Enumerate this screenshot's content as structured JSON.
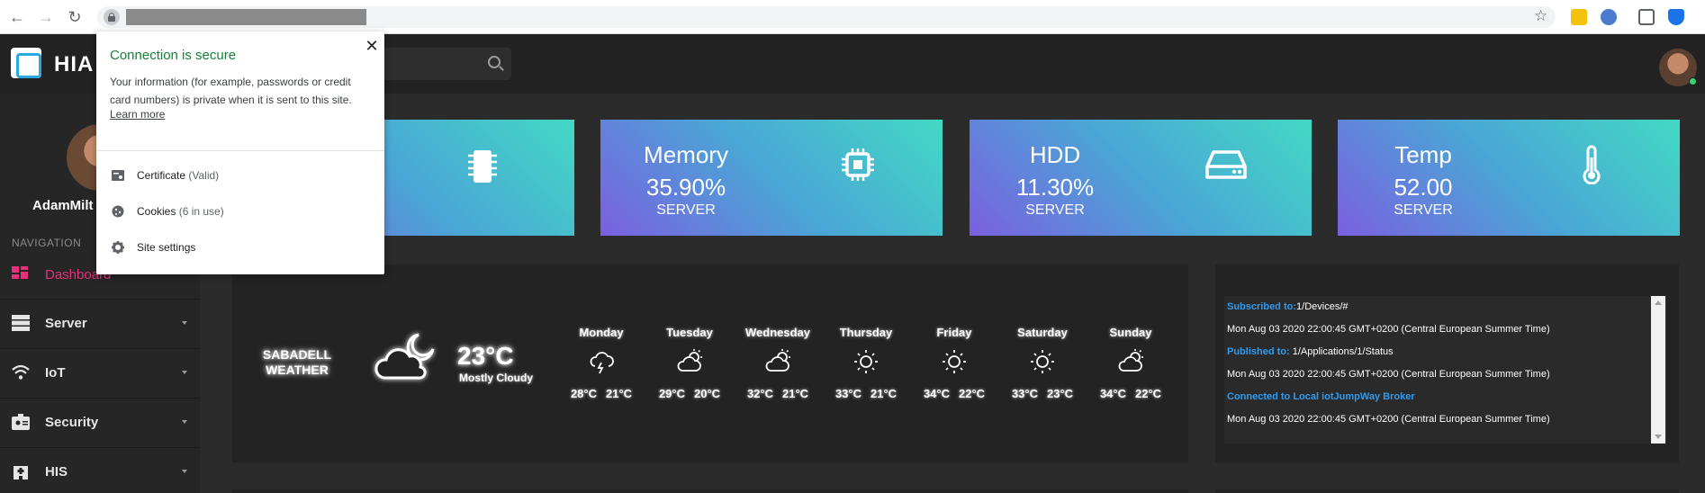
{
  "browser": {
    "back_icon": "←",
    "forward_icon": "→",
    "reload_icon": "↻",
    "bookmark_icon": "☆"
  },
  "header": {
    "brand": "HIA",
    "search_placeholder": ""
  },
  "sidebar": {
    "username": "AdamMilt",
    "nav_label": "NAVIGATION",
    "items": [
      {
        "label": "Dashboard",
        "icon": "dashboard-icon"
      },
      {
        "label": "Server",
        "icon": "server-icon"
      },
      {
        "label": "IoT",
        "icon": "wifi-icon"
      },
      {
        "label": "Security",
        "icon": "id-badge-icon"
      },
      {
        "label": "HIS",
        "icon": "hospital-icon"
      }
    ]
  },
  "cards": [
    {
      "title": "",
      "value": "",
      "sub": "",
      "icon": "cpu-chip-icon"
    },
    {
      "title": "Memory",
      "value": "35.90%",
      "sub": "SERVER",
      "icon": "memory-chip-icon"
    },
    {
      "title": "HDD",
      "value": "11.30%",
      "sub": "SERVER",
      "icon": "hard-drive-icon"
    },
    {
      "title": "Temp",
      "value": "52.00",
      "sub": "SERVER",
      "icon": "thermometer-icon"
    }
  ],
  "weather": {
    "city": "SABADELL",
    "label": "WEATHER",
    "temp": "23°C",
    "condition": "Mostly Cloudy",
    "main_icon": "partly-cloudy-night-icon",
    "days": [
      {
        "name": "Monday",
        "high": "28°C",
        "low": "21°C",
        "icon": "thunderstorm-icon"
      },
      {
        "name": "Tuesday",
        "high": "29°C",
        "low": "20°C",
        "icon": "partly-cloudy-icon"
      },
      {
        "name": "Wednesday",
        "high": "32°C",
        "low": "21°C",
        "icon": "partly-cloudy-icon"
      },
      {
        "name": "Thursday",
        "high": "33°C",
        "low": "21°C",
        "icon": "sun-icon"
      },
      {
        "name": "Friday",
        "high": "34°C",
        "low": "22°C",
        "icon": "sun-icon"
      },
      {
        "name": "Saturday",
        "high": "33°C",
        "low": "23°C",
        "icon": "sun-icon"
      },
      {
        "name": "Sunday",
        "high": "34°C",
        "low": "22°C",
        "icon": "partly-cloudy-icon"
      }
    ]
  },
  "log": [
    {
      "key": "Subscribed to:",
      "text": "1/Devices/#"
    },
    {
      "key": "",
      "text": "Mon Aug 03 2020 22:00:45 GMT+0200 (Central European Summer Time)"
    },
    {
      "key": "Published to:",
      "text": " 1/Applications/1/Status"
    },
    {
      "key": "",
      "text": "Mon Aug 03 2020 22:00:45 GMT+0200 (Central European Summer Time)"
    },
    {
      "key": "Connected to Local iotJumpWay Broker",
      "text": ""
    },
    {
      "key": "",
      "text": "Mon Aug 03 2020 22:00:45 GMT+0200 (Central European Summer Time)"
    }
  ],
  "popup": {
    "title": "Connection is secure",
    "close": "✕",
    "body": "Your information (for example, passwords or credit card numbers) is private when it is sent to this site.",
    "learn_more": "Learn more",
    "rows": [
      {
        "label": "Certificate",
        "note": " (Valid)",
        "icon": "certificate-icon"
      },
      {
        "label": "Cookies",
        "note": " (6 in use)",
        "icon": "cookie-icon"
      },
      {
        "label": "Site settings",
        "note": "",
        "icon": "gear-icon"
      }
    ]
  },
  "colors": {
    "accent": "#e8307a",
    "log_key": "#2e9bf0",
    "secure_green": "#188038"
  }
}
